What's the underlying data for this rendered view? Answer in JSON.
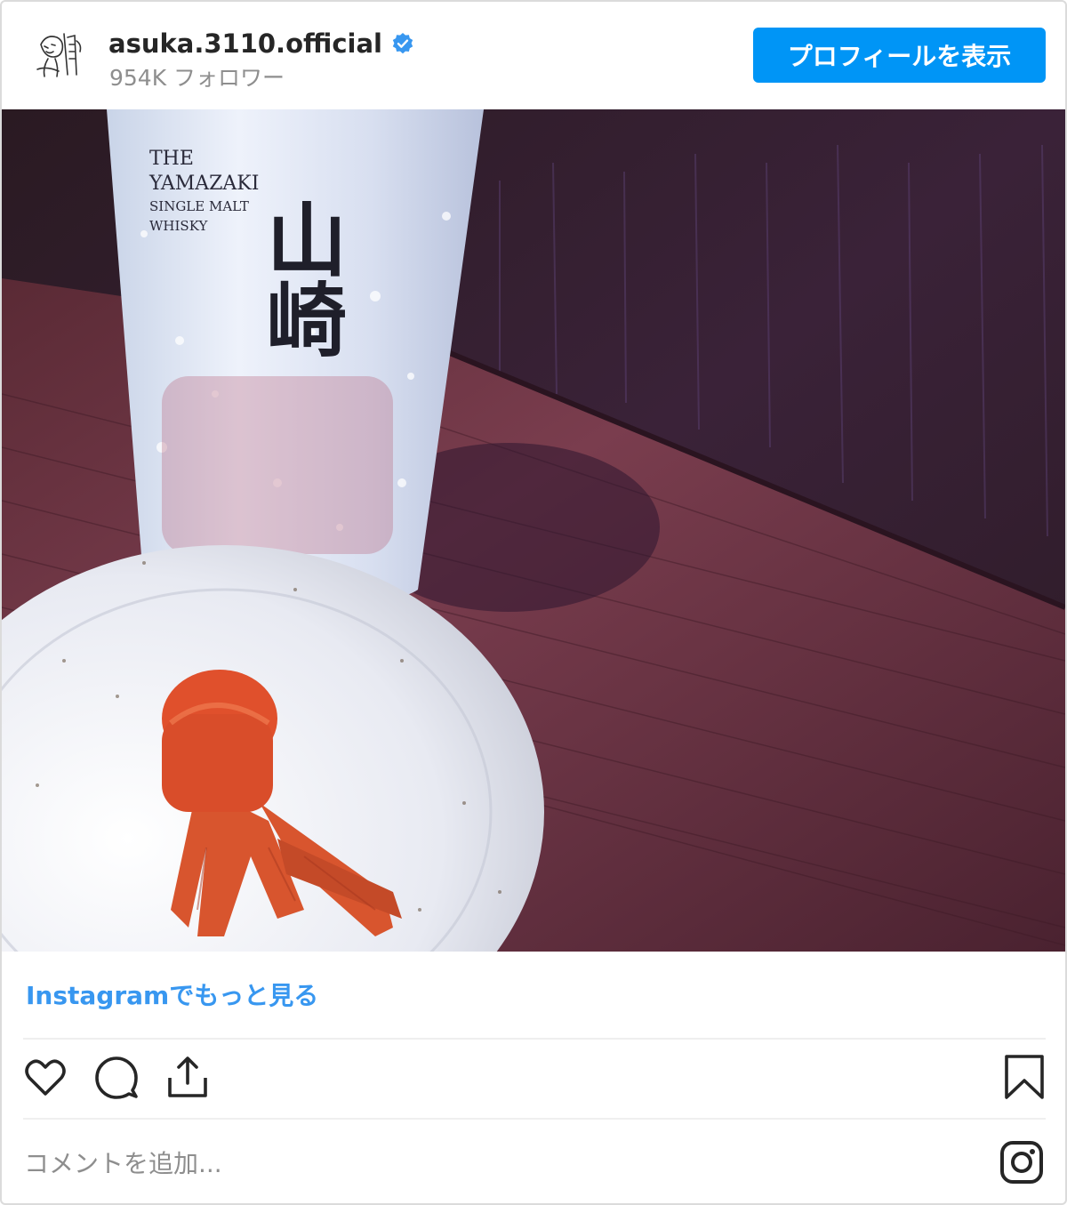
{
  "header": {
    "username": "asuka.3110.official",
    "verified": true,
    "followers": "954K フォロワー",
    "profile_button": "プロフィールを表示"
  },
  "photo": {
    "glass_text_line1": "THE",
    "glass_text_line2": "YAMAZAKI",
    "glass_text_line3": "SINGLE MALT",
    "glass_text_line4": "WHISKY",
    "glass_kanji": "山崎"
  },
  "footer": {
    "more_link": "Instagramでもっと見る",
    "comment_placeholder": "コメントを追加..."
  },
  "icons": {
    "like": "heart-icon",
    "comment": "comment-icon",
    "share": "share-icon",
    "save": "bookmark-icon",
    "logo": "instagram-icon"
  },
  "colors": {
    "accent": "#0095f6",
    "link": "#3897f0",
    "verified": "#3897f0",
    "muted": "#8e8e8e"
  }
}
